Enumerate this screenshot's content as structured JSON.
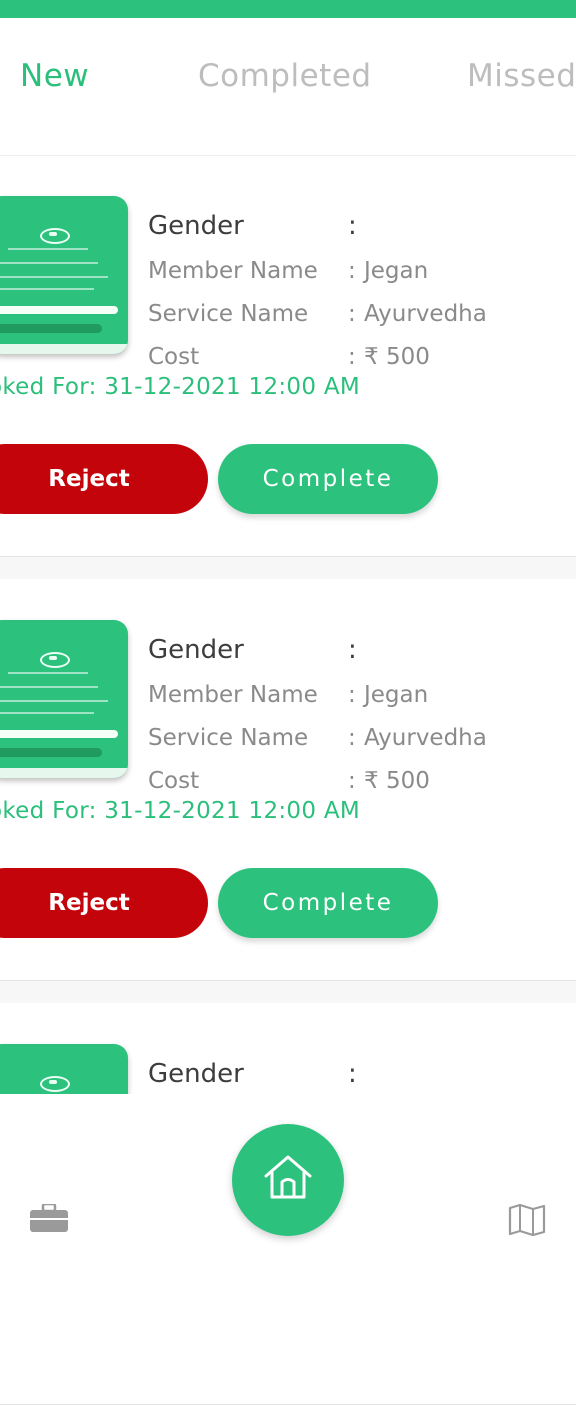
{
  "app": {
    "accent_color": "#2cc27e",
    "reject_color": "#c4040b"
  },
  "tabs": [
    {
      "label": "New",
      "active": true
    },
    {
      "label": "Completed",
      "active": false
    },
    {
      "label": "Missed",
      "active": false
    }
  ],
  "labels": {
    "gender": "Gender",
    "member_name": "Member Name",
    "service_name": "Service Name",
    "cost": "Cost",
    "colon": ":",
    "booked_for_prefix": "oked For: ",
    "reject": "Reject",
    "complete": "Complete"
  },
  "appointments": [
    {
      "gender": "",
      "member_name": "Jegan",
      "service_name": "Ayurvedha",
      "cost": "₹ 500",
      "booked_for": "31-12-2021 12:00 AM"
    },
    {
      "gender": "",
      "member_name": "Jegan",
      "service_name": "Ayurvedha",
      "cost": "₹ 500",
      "booked_for": "31-12-2021 12:00 AM"
    },
    {
      "gender": "",
      "member_name": "",
      "service_name": "",
      "cost": "",
      "booked_for": ""
    }
  ],
  "bottom_nav": {
    "left_icon": "briefcase-icon",
    "center_icon": "home-icon",
    "right_icon": "map-icon"
  }
}
